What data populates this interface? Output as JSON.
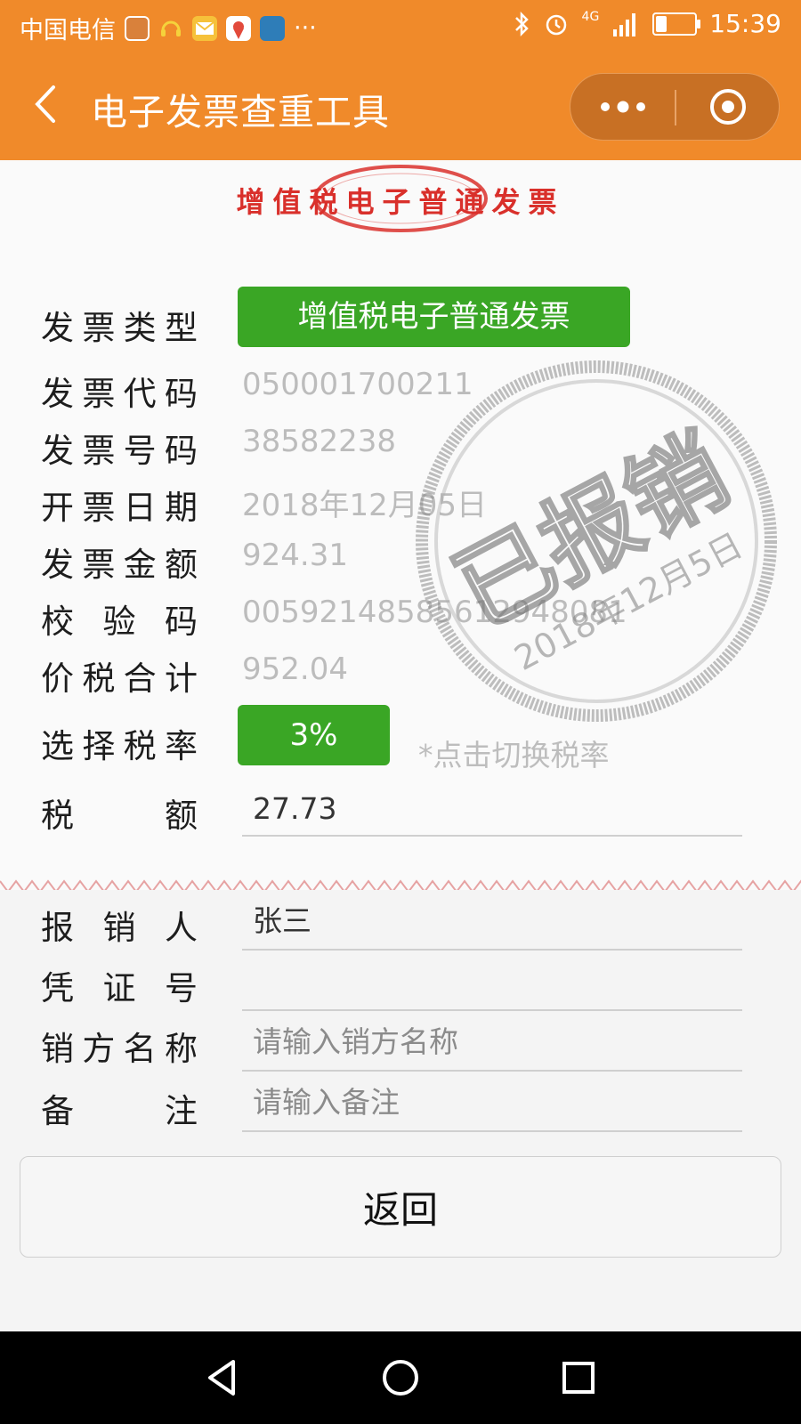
{
  "status_bar": {
    "carrier": "中国电信",
    "more": "···",
    "network": "4G",
    "time": "15:39",
    "battery_level": 0.3
  },
  "nav": {
    "title": "电子发票查重工具"
  },
  "invoice_header": {
    "title": "增值税电子普通发票"
  },
  "fields": {
    "type_label": "发票类型",
    "type_value": "增值税电子普通发票",
    "code_label": "发票代码",
    "code_value": "050001700211",
    "number_label": "发票号码",
    "number_value": "38582238",
    "date_label": "开票日期",
    "date_value": "2018年12月05日",
    "amount_label": "发票金额",
    "amount_value": "924.31",
    "check_label": "校验码",
    "check_value": "00592148585612948081",
    "total_label": "价税合计",
    "total_value": "952.04",
    "rate_label": "选择税率",
    "rate_value": "3%",
    "rate_hint": "*点击切换税率",
    "tax_label": "税额",
    "tax_value": "27.73"
  },
  "reimburse": {
    "person_label": "报销人",
    "person_value": "张三",
    "voucher_label": "凭证号",
    "voucher_value": "",
    "seller_label": "销方名称",
    "seller_placeholder": "请输入销方名称",
    "remark_label": "备注",
    "remark_placeholder": "请输入备注"
  },
  "stamp": {
    "text": "已报销",
    "date": "2018年12月5日"
  },
  "return_button": "返回",
  "colors": {
    "header_orange": "#f08a2a",
    "primary_green": "#3aa625",
    "invoice_red": "#d9302b"
  }
}
